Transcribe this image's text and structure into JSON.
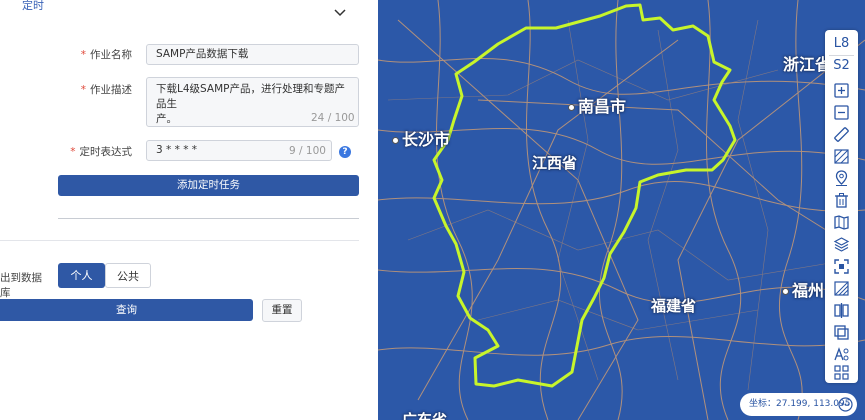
{
  "form": {
    "section_title": "定时",
    "job_name": {
      "label": "作业名称",
      "value": "SAMP产品数据下载"
    },
    "job_desc": {
      "label": "作业描述",
      "line1": "下载L4级SAMP产品，进行处理和专题产品生",
      "line2": "产。",
      "count": "24 / 100"
    },
    "cron": {
      "label": "定时表达式",
      "value": "3 * * * *",
      "count": "9 / 100",
      "help": "?"
    },
    "add_task_label": "添加定时任务",
    "db_label": "出到数据库",
    "seg_personal": "个人",
    "seg_public": "公共",
    "query_label": "查询",
    "reset_label": "重置"
  },
  "map": {
    "colors": {
      "background": "#2c58a8",
      "border": "#c7f52b",
      "roads": "#c89a75"
    },
    "cities": {
      "nanchang": "南昌市",
      "changsha": "长沙市",
      "jiangxi": "江西省",
      "zhejiang": "浙江省",
      "fuzhou": "福州",
      "fujian": "福建省",
      "bottom": "广东省"
    },
    "toolbar": {
      "level": "L8",
      "source": "S2",
      "icons": [
        "zoom-in-icon",
        "zoom-out-icon",
        "ruler-icon",
        "hatch-area-icon",
        "location-pin-icon",
        "trash-icon",
        "map-book-icon",
        "layers-icon",
        "fullscreen-icon",
        "swipe-icon",
        "split-compare-icon",
        "overlap-icon",
        "label-style-icon",
        "grid-icon"
      ]
    },
    "coordinates": "坐标：27.199, 113.095"
  }
}
